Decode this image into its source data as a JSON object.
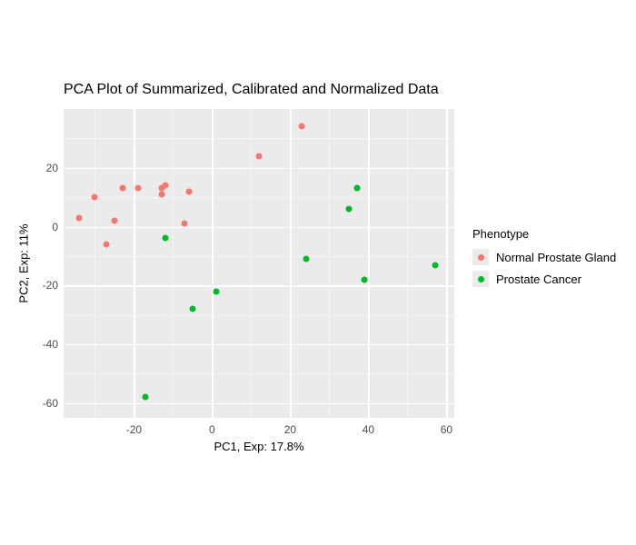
{
  "chart_data": {
    "type": "scatter",
    "title": "PCA Plot of Summarized, Calibrated and Normalized Data",
    "xlabel": "PC1, Exp: 17.8%",
    "ylabel": "PC2, Exp: 11%",
    "xlim": [
      -38,
      62
    ],
    "ylim": [
      -65,
      40
    ],
    "x_ticks": [
      -20,
      0,
      20,
      40,
      60
    ],
    "y_ticks": [
      -60,
      -40,
      -20,
      0,
      20
    ],
    "grid": true,
    "legend_title": "Phenotype",
    "legend_position": "right",
    "series": [
      {
        "name": "Normal Prostate Gland",
        "color": "#f8766d",
        "points": [
          {
            "x": -34,
            "y": 3
          },
          {
            "x": -30,
            "y": 10
          },
          {
            "x": -27,
            "y": -6
          },
          {
            "x": -25,
            "y": 2
          },
          {
            "x": -23,
            "y": 13
          },
          {
            "x": -19,
            "y": 13
          },
          {
            "x": -13,
            "y": 13
          },
          {
            "x": -13,
            "y": 11
          },
          {
            "x": -12,
            "y": 14
          },
          {
            "x": -6,
            "y": 12
          },
          {
            "x": -7,
            "y": 1
          },
          {
            "x": 12,
            "y": 24
          },
          {
            "x": 23,
            "y": 34
          }
        ]
      },
      {
        "name": "Prostate Cancer",
        "color": "#00ba28",
        "points": [
          {
            "x": -17,
            "y": -58
          },
          {
            "x": -12,
            "y": -4
          },
          {
            "x": -5,
            "y": -28
          },
          {
            "x": 1,
            "y": -22
          },
          {
            "x": 24,
            "y": -11
          },
          {
            "x": 35,
            "y": 6
          },
          {
            "x": 37,
            "y": 13
          },
          {
            "x": 39,
            "y": -18
          },
          {
            "x": 57,
            "y": -13
          }
        ]
      }
    ]
  }
}
